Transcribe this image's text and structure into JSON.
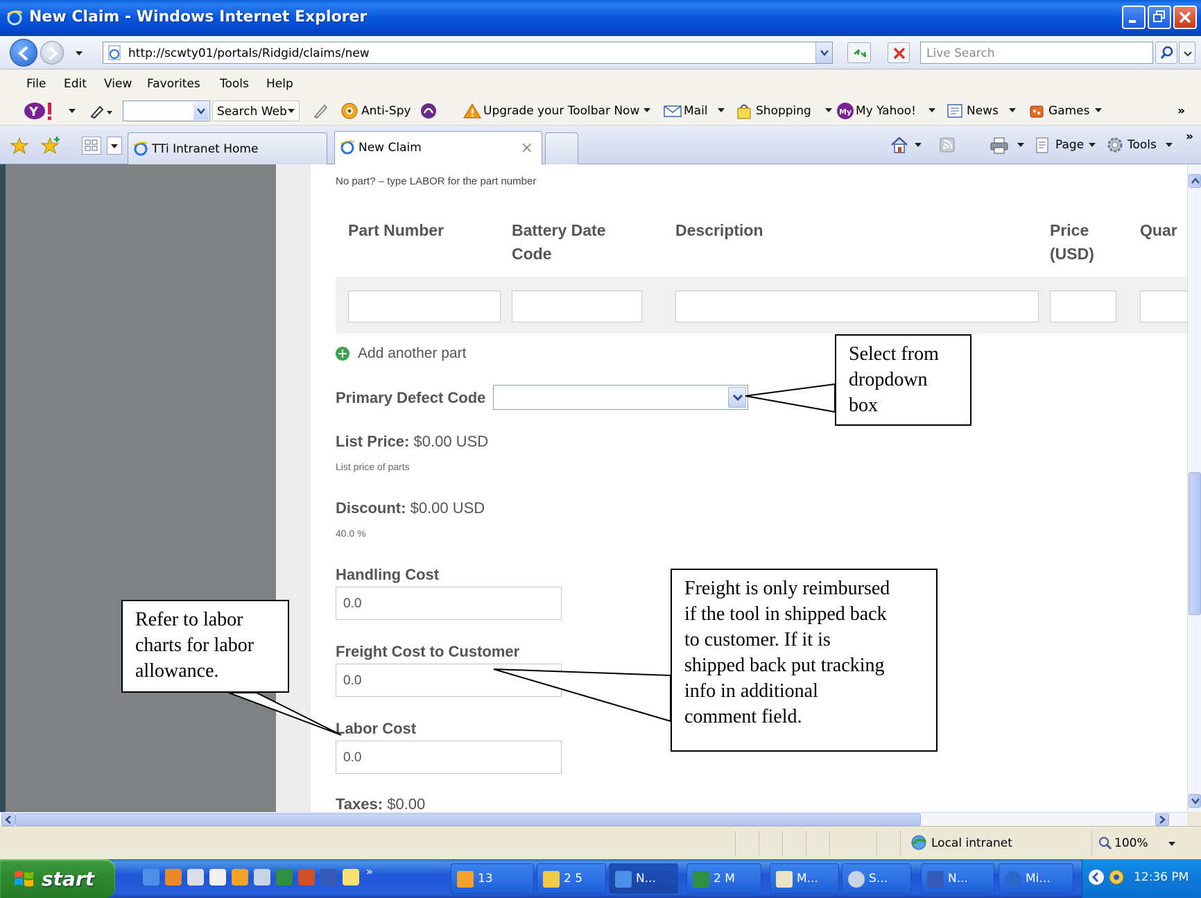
{
  "window": {
    "title": "New Claim - Windows Internet Explorer"
  },
  "address": {
    "url": "http://scwty01/portals/Ridgid/claims/new",
    "search_placeholder": "Live Search"
  },
  "menu": [
    "File",
    "Edit",
    "View",
    "Favorites",
    "Tools",
    "Help"
  ],
  "toolbar": {
    "search_web": "Search Web",
    "anti_spy": "Anti-Spy",
    "upgrade": "Upgrade your Toolbar Now",
    "mail": "Mail",
    "shopping": "Shopping",
    "my_yahoo": "My Yahoo!",
    "news": "News",
    "games": "Games",
    "more": "»"
  },
  "tabs": {
    "home": "TTi Intranet Home",
    "active": "New Claim",
    "close": "×"
  },
  "commands": {
    "page": "Page",
    "tools": "Tools"
  },
  "form": {
    "no_part_note": "No part? – type LABOR for the part number",
    "columns": [
      "Part Number",
      "Battery Date Code",
      "Description",
      "Price (USD)",
      "Quar"
    ],
    "add_part": "Add another part",
    "defect_label": "Primary Defect Code",
    "list_price_label": "List Price:",
    "list_price_value": "$0.00 USD",
    "list_price_note": "List price of parts",
    "discount_label": "Discount:",
    "discount_value": "$0.00 USD",
    "discount_pct": "40.0 %",
    "handling_label": "Handling Cost",
    "handling_value": "0.0",
    "freight_label": "Freight Cost to Customer",
    "freight_value": "0.0",
    "labor_label": "Labor Cost",
    "labor_value": "0.0",
    "taxes_label": "Taxes:",
    "taxes_value": "$0.00"
  },
  "callouts": {
    "dropdown": "Select from\ndropdown\nbox",
    "freight": "Freight is only reimbursed\nif the tool in shipped back\nto customer.  If it is\nshipped back put tracking\ninfo in additional\ncomment field.",
    "labor": "Refer to labor\ncharts for labor\nallowance."
  },
  "status": {
    "zone": "Local intranet",
    "zoom": "100%"
  },
  "taskbar": {
    "start": "start",
    "tasks": [
      "13",
      "2 5",
      "N...",
      "2 M",
      "M...",
      "S...",
      "N...",
      "Mi..."
    ],
    "more": "»",
    "clock": "12:36 PM"
  }
}
